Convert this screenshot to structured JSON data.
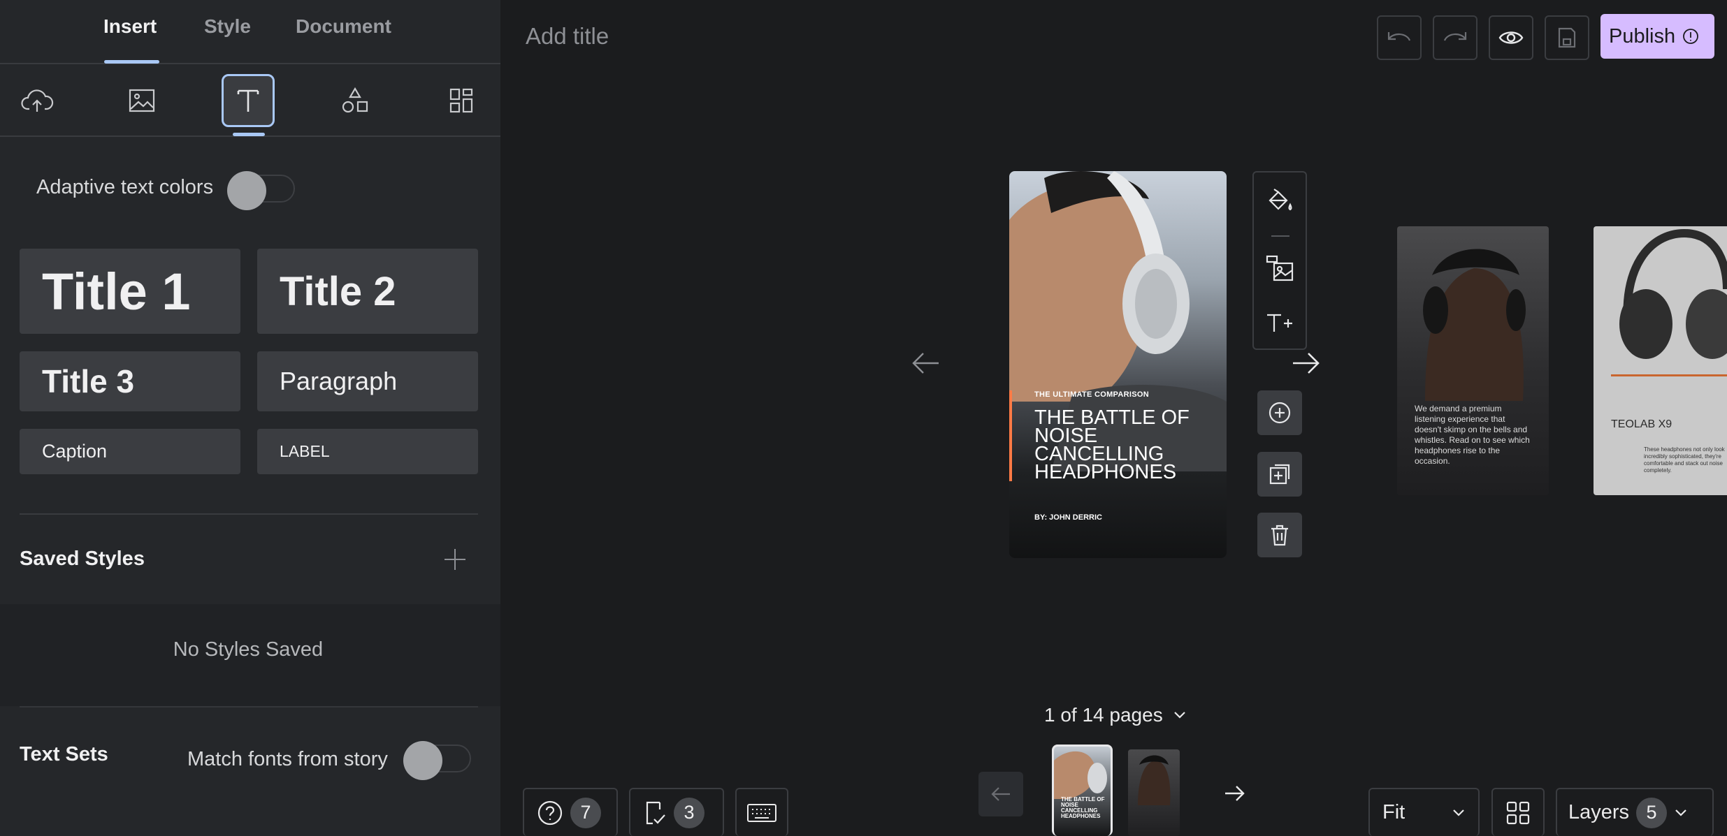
{
  "tabs": {
    "insert": "Insert",
    "style": "Style",
    "document": "Document"
  },
  "insert_icons": [
    "upload-icon",
    "image-icon",
    "text-icon",
    "shapes-icon",
    "grid-icon"
  ],
  "adaptive_label": "Adaptive text colors",
  "presets": {
    "title1": "Title 1",
    "title2": "Title 2",
    "title3": "Title 3",
    "paragraph": "Paragraph",
    "caption": "Caption",
    "label": "LABEL"
  },
  "saved_styles": {
    "title": "Saved Styles",
    "empty": "No Styles Saved"
  },
  "text_sets": {
    "title": "Text Sets",
    "match_label": "Match fonts from story"
  },
  "header": {
    "title_placeholder": "Add title",
    "publish": "Publish"
  },
  "main_page": {
    "subtitle": "THE ULTIMATE COMPARISON",
    "title": "THE BATTLE OF NOISE CANCELLING HEADPHONES",
    "byline": "BY: JOHN DERRIC"
  },
  "page2": {
    "text": "We demand a premium listening experience that doesn't skimp on the bells and whistles. Read on to see which headphones rise to the occasion."
  },
  "page3": {
    "title": "TEOLAB X9",
    "text": "These headphones not only look incredibly sophisticated, they're comfortable and stack out noise completely."
  },
  "footer": {
    "page_counter": "1 of 14 pages",
    "help_count": "7",
    "checklist_count": "3",
    "zoom": "Fit",
    "layers_label": "Layers",
    "layers_count": "5"
  },
  "colors": {
    "accent": "#a9c8f5",
    "publish": "#d6bcff",
    "orange_bar": "#ff7a45"
  }
}
